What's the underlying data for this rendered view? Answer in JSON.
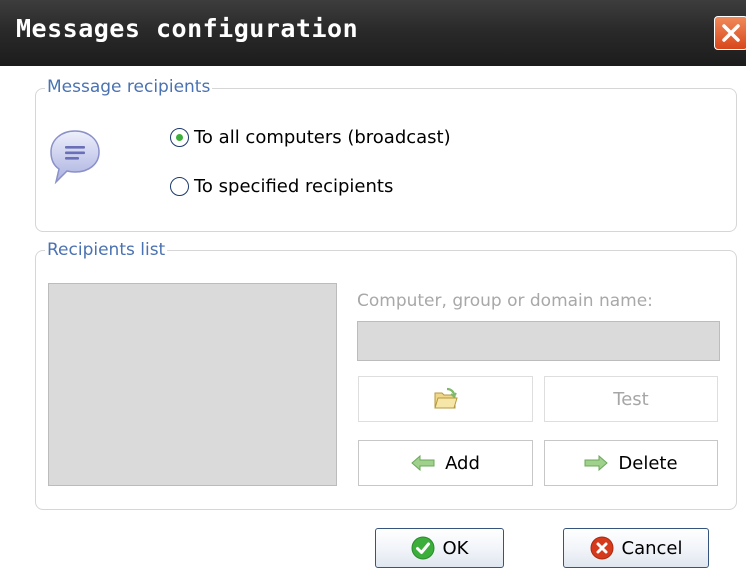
{
  "window": {
    "title": "Messages configuration"
  },
  "recipients_group": {
    "legend": "Message recipients",
    "options": [
      {
        "label": "To all computers (broadcast)",
        "checked": true
      },
      {
        "label": "To specified recipients",
        "checked": false
      }
    ]
  },
  "list_group": {
    "legend": "Recipients list",
    "field_label": "Computer, group or domain name:",
    "field_value": "",
    "buttons": {
      "browse_label": "",
      "test_label": "Test",
      "add_label": "Add",
      "delete_label": "Delete"
    }
  },
  "footer": {
    "ok_label": "OK",
    "cancel_label": "Cancel"
  },
  "icons": {
    "close": "close-icon",
    "message": "speech-bubble-icon",
    "browse": "folder-icon",
    "add": "arrow-left-icon",
    "delete": "arrow-right-icon",
    "ok": "checkmark-icon",
    "cancel": "cancel-icon"
  },
  "colors": {
    "titlebar": "#2a2a2a",
    "legend": "#4a72b2",
    "close": "#d8471c",
    "ok": "#3cae3c",
    "cancel": "#d63a1c"
  }
}
